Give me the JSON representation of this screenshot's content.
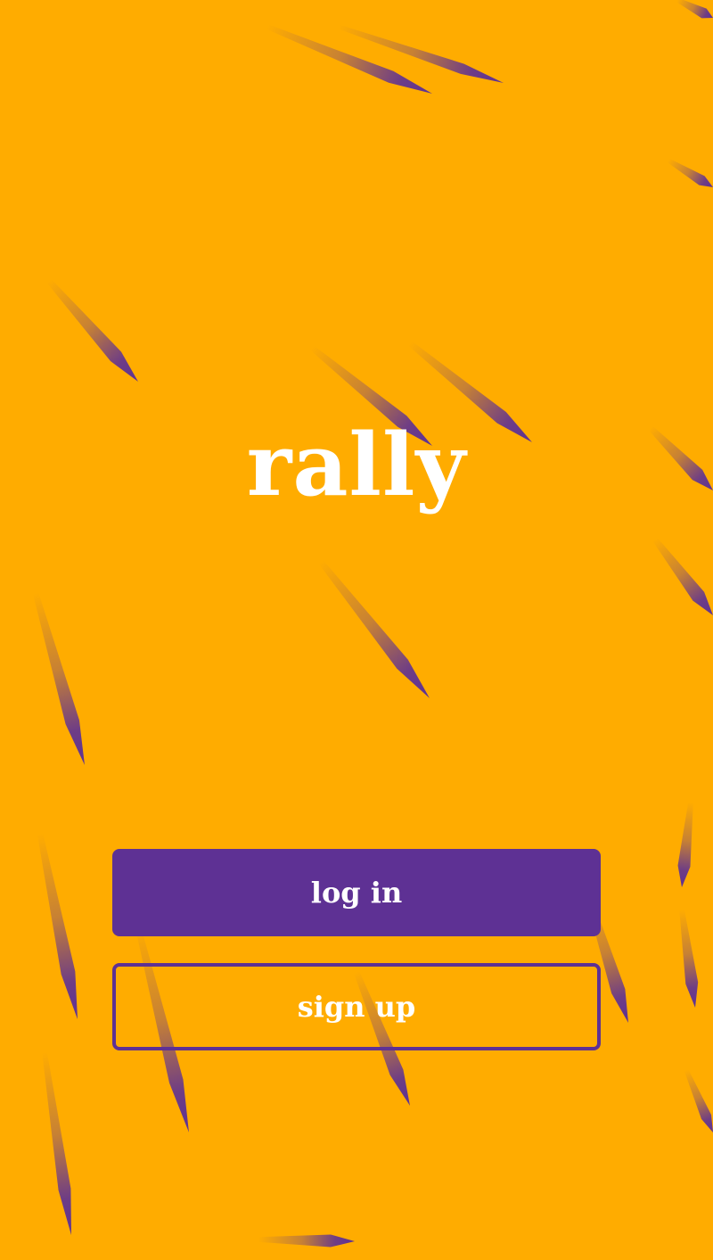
{
  "app": {
    "logo_text": "rally"
  },
  "actions": {
    "login_label": "log in",
    "signup_label": "sign up"
  },
  "colors": {
    "background": "#FFAC00",
    "accent": "#5E3194",
    "text": "#FFFFFF"
  }
}
